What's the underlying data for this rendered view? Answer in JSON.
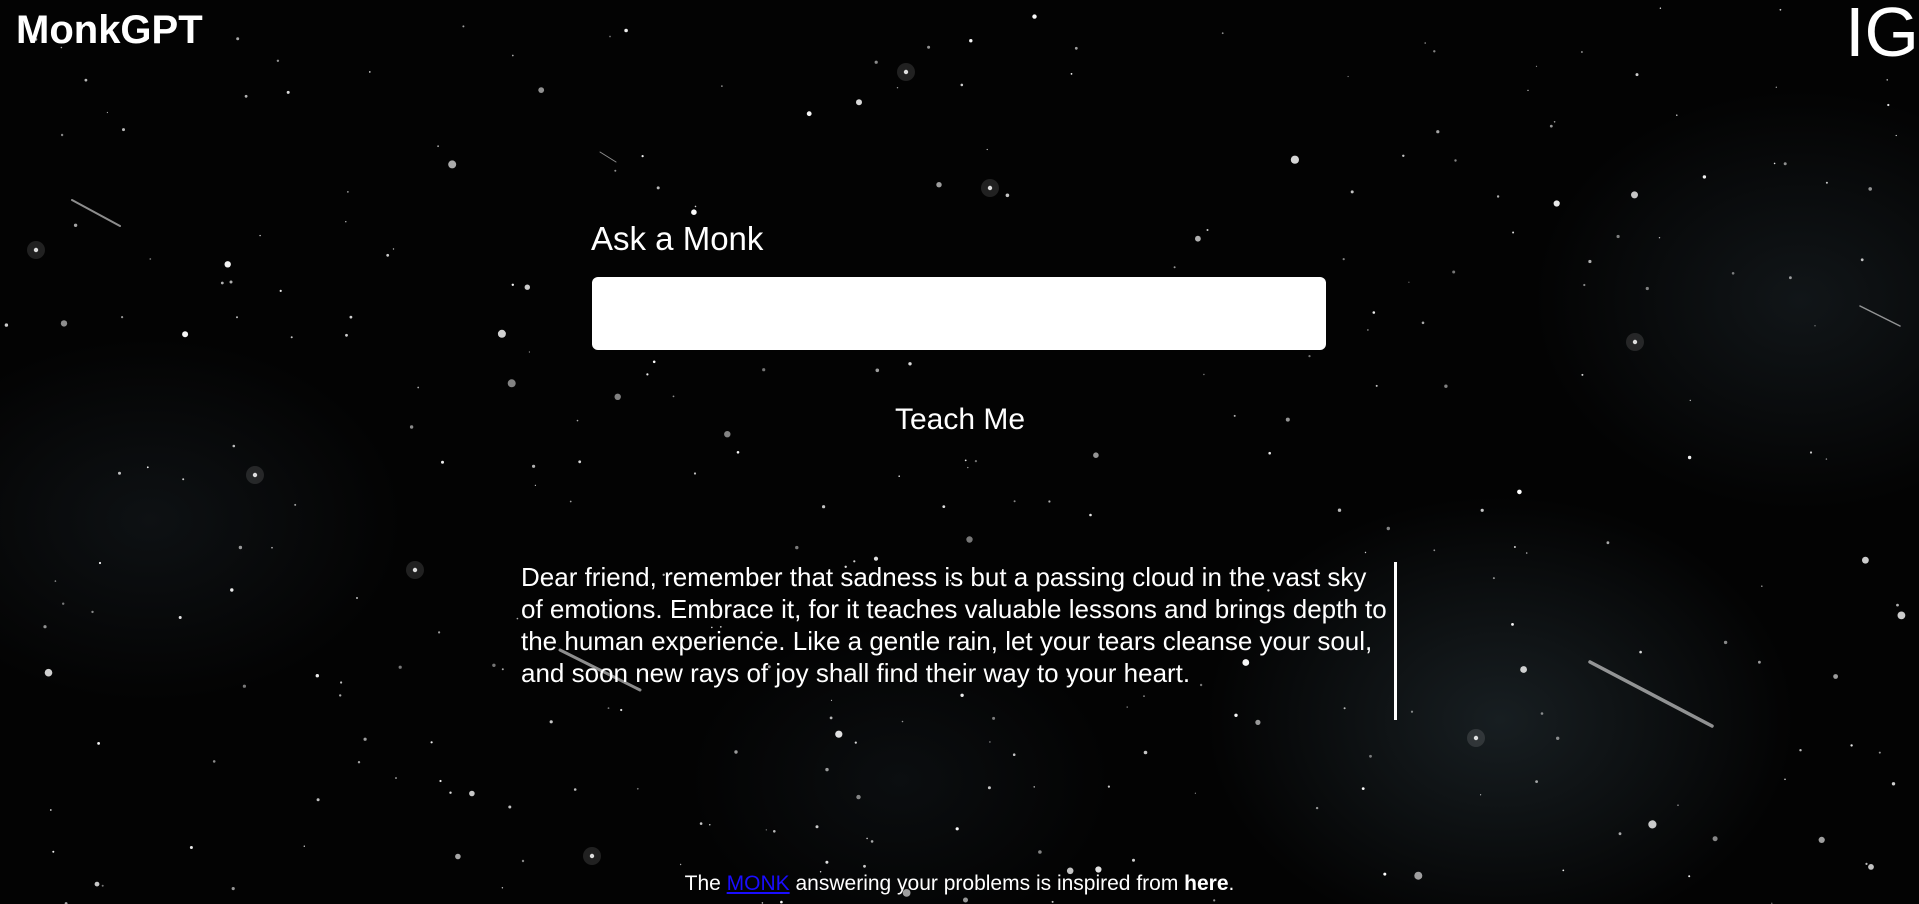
{
  "header": {
    "brand": "MonkGPT",
    "social_link": "IG"
  },
  "form": {
    "label": "Ask a Monk",
    "input_value": "",
    "input_placeholder": "",
    "submit_label": "Teach Me"
  },
  "answer": {
    "text": "Dear friend, remember that sadness is but a passing cloud in the vast sky of emotions. Embrace it, for it teaches valuable lessons and brings depth to the human experience. Like a gentle rain, let your tears cleanse your soul, and soon new rays of joy shall find their way to your heart."
  },
  "footer": {
    "prefix": "The",
    "monk_link": "MONK",
    "middle": "answering your problems is inspired from",
    "here": "here",
    "suffix": "."
  },
  "colors": {
    "background": "#030303",
    "text": "#ffffff",
    "link": "#1a0dff"
  }
}
